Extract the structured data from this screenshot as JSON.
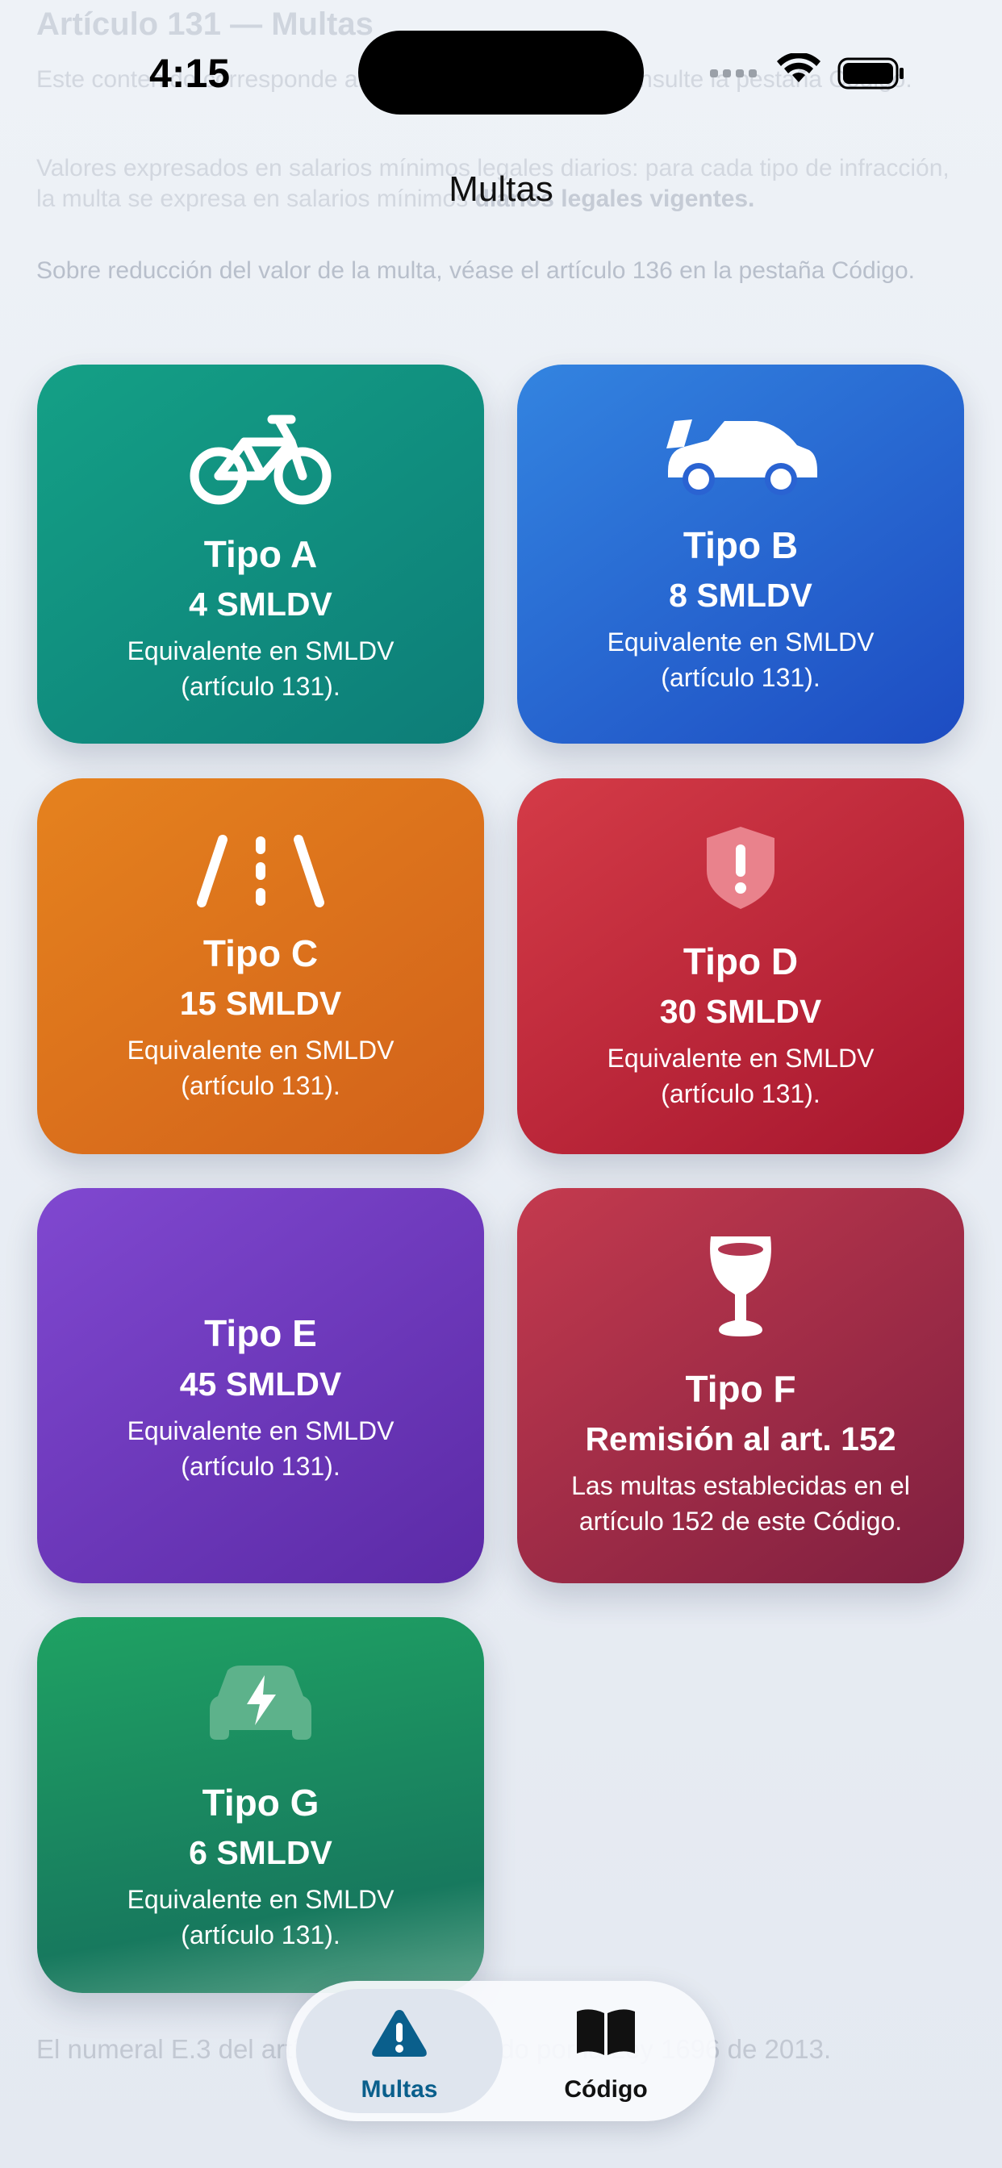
{
  "status_bar": {
    "time": "4:15"
  },
  "background_doc": {
    "heading": "Artículo 131 — Multas",
    "para1": "Este contenido corresponde al texto del artículo 131. Consulte la pestaña Código.",
    "para2_lead": "Valores expresados en salarios mínimos legales diarios: para cada tipo de infracción, la multa se expresa en salarios mínimos",
    "para2_bold": "diarios legales vigentes.",
    "para3": "Sobre reducción del valor de la multa, véase el artículo 136 en la pestaña Código.",
    "footer": "El numeral E.3 del artículo fue modificado por la Ley 1696 de 2013."
  },
  "nav": {
    "title": "Multas"
  },
  "cards": [
    {
      "title": "Tipo A",
      "amount": "4 SMLDV",
      "desc_line1": "Equivalente en SMLDV",
      "desc_line2": "(artículo 131).",
      "icon": "bicycle-icon",
      "color": "#14a086"
    },
    {
      "title": "Tipo B",
      "amount": "8 SMLDV",
      "desc_line1": "Equivalente en SMLDV",
      "desc_line2": "(artículo 131).",
      "icon": "car-open-trunk-icon",
      "color": "#2f6fdb"
    },
    {
      "title": "Tipo C",
      "amount": "15 SMLDV",
      "desc_line1": "Equivalente en SMLDV",
      "desc_line2": "(artículo 131).",
      "icon": "road-lanes-icon",
      "color": "#e07420"
    },
    {
      "title": "Tipo D",
      "amount": "30 SMLDV",
      "desc_line1": "Equivalente en SMLDV",
      "desc_line2": "(artículo 131).",
      "icon": "shield-exclamation-icon",
      "color": "#c62c3e"
    },
    {
      "title": "Tipo E",
      "amount": "45 SMLDV",
      "desc_line1": "Equivalente en SMLDV",
      "desc_line2": "(artículo 131).",
      "icon": "",
      "color": "#6d38bd"
    },
    {
      "title": "Tipo F",
      "amount": "Remisión al art. 152",
      "desc_line1": "Las multas establecidas en el",
      "desc_line2": "artículo 152 de este Código.",
      "icon": "wine-glass-icon",
      "color": "#a42c48"
    },
    {
      "title": "Tipo G",
      "amount": "6 SMLDV",
      "desc_line1": "Equivalente en SMLDV",
      "desc_line2": "(artículo 131).",
      "icon": "electric-car-icon",
      "color": "#1c8f61"
    }
  ],
  "tabbar": {
    "tabs": [
      {
        "label": "Multas",
        "icon": "warning-triangle-icon",
        "selected": true
      },
      {
        "label": "Código",
        "icon": "open-book-icon",
        "selected": false
      }
    ],
    "accent": "#0a5f8c"
  }
}
